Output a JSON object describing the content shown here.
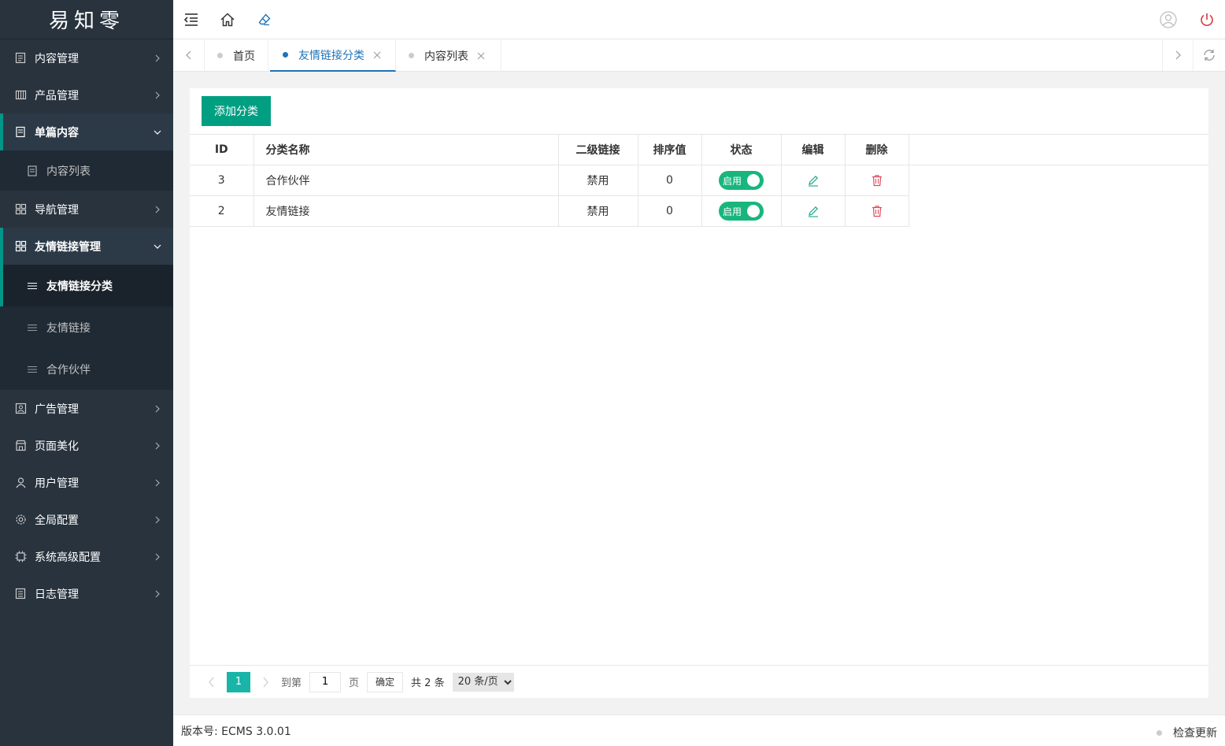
{
  "app": {
    "logo_text": "易知零"
  },
  "sidebar": {
    "items": [
      {
        "label": "内容管理",
        "icon": "content-icon"
      },
      {
        "label": "产品管理",
        "icon": "product-icon"
      },
      {
        "label": "单篇内容",
        "icon": "page-icon",
        "children": [
          {
            "label": "内容列表"
          }
        ]
      },
      {
        "label": "导航管理",
        "icon": "grid-icon"
      },
      {
        "label": "友情链接管理",
        "icon": "grid-icon",
        "children": [
          {
            "label": "友情链接分类"
          },
          {
            "label": "友情链接"
          },
          {
            "label": "合作伙伴"
          }
        ]
      },
      {
        "label": "广告管理",
        "icon": "image-icon"
      },
      {
        "label": "页面美化",
        "icon": "store-icon"
      },
      {
        "label": "用户管理",
        "icon": "user-icon"
      },
      {
        "label": "全局配置",
        "icon": "gear-icon"
      },
      {
        "label": "系统高级配置",
        "icon": "chip-icon"
      },
      {
        "label": "日志管理",
        "icon": "log-icon"
      }
    ]
  },
  "tabs": [
    {
      "label": "首页"
    },
    {
      "label": "友情链接分类"
    },
    {
      "label": "内容列表"
    }
  ],
  "toolbar": {
    "add_label": "添加分类"
  },
  "table": {
    "headers": [
      "ID",
      "分类名称",
      "二级链接",
      "排序值",
      "状态",
      "编辑",
      "删除"
    ],
    "rows": [
      {
        "id": "3",
        "name": "合作伙伴",
        "sub_link": "禁用",
        "sort": "0",
        "status": "启用"
      },
      {
        "id": "2",
        "name": "友情链接",
        "sub_link": "禁用",
        "sort": "0",
        "status": "启用"
      }
    ]
  },
  "pager": {
    "current": "1",
    "goto_label": "到第",
    "page_input": "1",
    "page_unit": "页",
    "confirm": "确定",
    "total": "共 2 条",
    "page_size": "20 条/页"
  },
  "footer": {
    "version": "版本号: ECMS 3.0.01",
    "check_update": "检查更新"
  },
  "colors": {
    "accent": "#009f82",
    "sidebar_bg": "#28333e",
    "tab_active": "#1e73b9",
    "switch_on": "#18b67c",
    "delete_red": "#e0475b"
  }
}
